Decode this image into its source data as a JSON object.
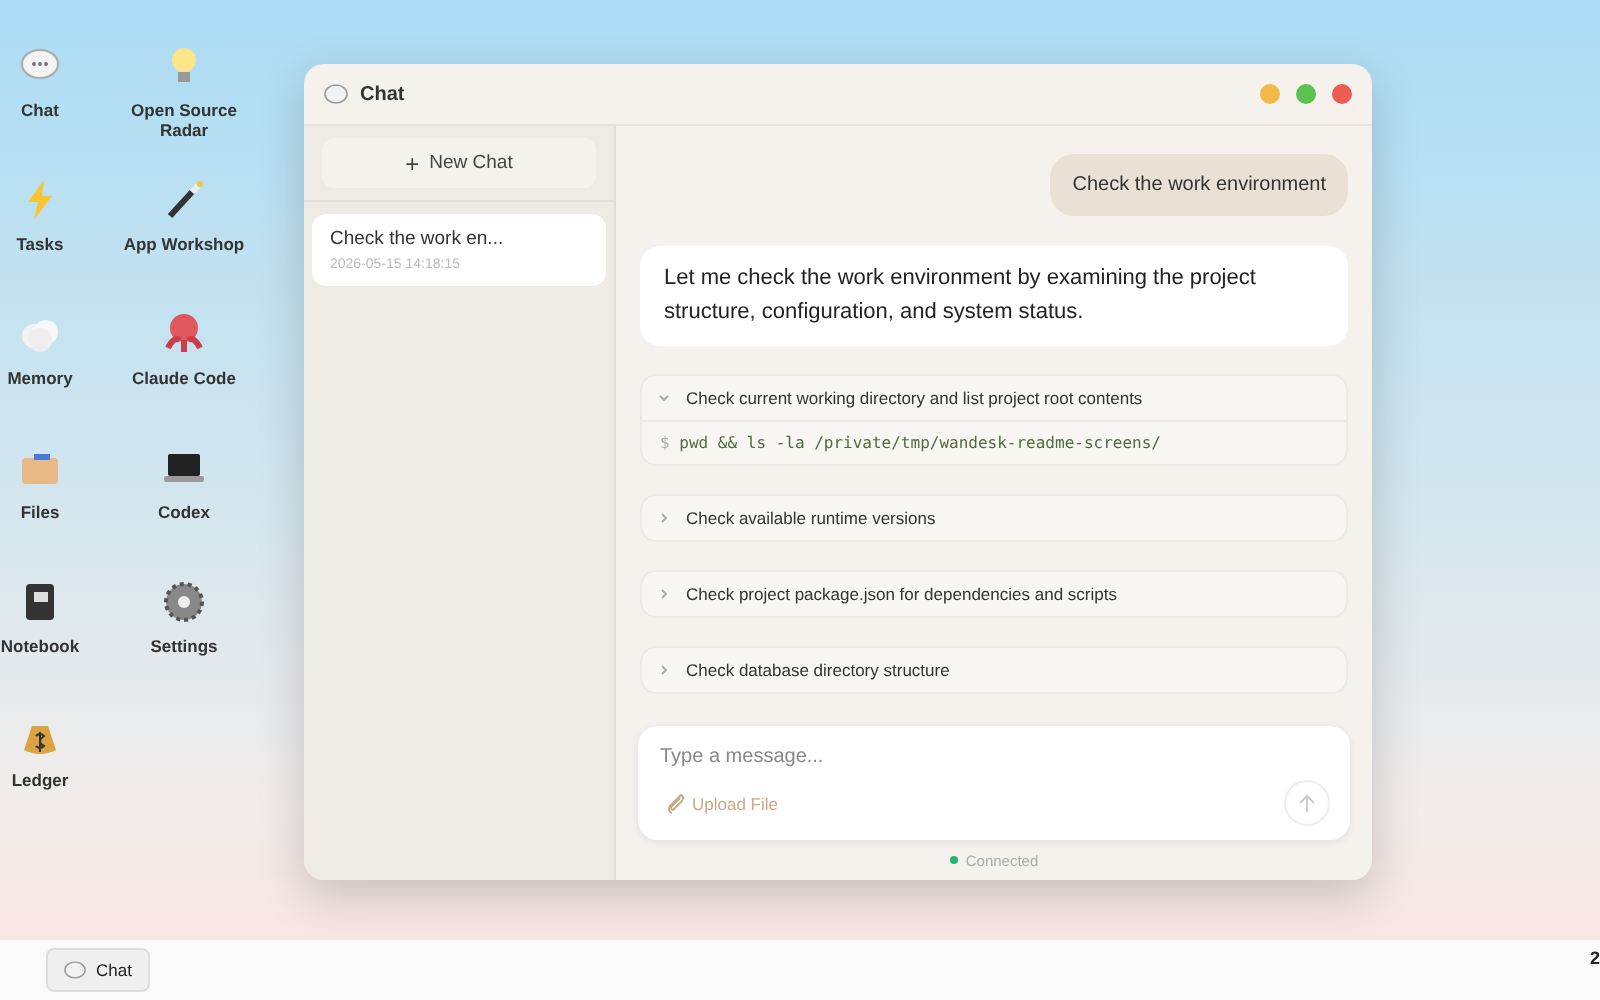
{
  "desktop_icons": [
    {
      "label": "Chat"
    },
    {
      "label": "Open Source Radar"
    },
    {
      "label": "Tasks"
    },
    {
      "label": "App Workshop"
    },
    {
      "label": "Memory"
    },
    {
      "label": "Claude Code"
    },
    {
      "label": "Files"
    },
    {
      "label": "Codex"
    },
    {
      "label": "Notebook"
    },
    {
      "label": "Settings"
    },
    {
      "label": "Ledger"
    }
  ],
  "window": {
    "title": "Chat"
  },
  "sidebar": {
    "new_chat": "New Chat",
    "new_chat_icon": "+",
    "conversations": [
      {
        "title": "Check the work en...",
        "time": "2026-05-15 14:18:15",
        "selected": true
      }
    ]
  },
  "messages": [
    {
      "kind": "user",
      "text": "Check the work environment"
    },
    {
      "kind": "assistant",
      "text": "Let me check the work environment by examining the project structure, configuration, and system status."
    }
  ],
  "steps": [
    {
      "title": "Check current working directory and list project root contents",
      "expanded": true,
      "command": "pwd && ls -la /private/tmp/wandesk-readme-screens/",
      "prompt": "$"
    },
    {
      "title": "Check available runtime versions",
      "expanded": false
    },
    {
      "title": "Check project package.json for dependencies and scripts",
      "expanded": false
    },
    {
      "title": "Check database directory structure",
      "expanded": false
    }
  ],
  "composer": {
    "placeholder": "Type a message...",
    "upload": "Upload File"
  },
  "status": {
    "text": "Connected",
    "connected": true
  },
  "taskbar": {
    "items": [
      {
        "label": "Chat"
      }
    ],
    "clock": "2"
  }
}
